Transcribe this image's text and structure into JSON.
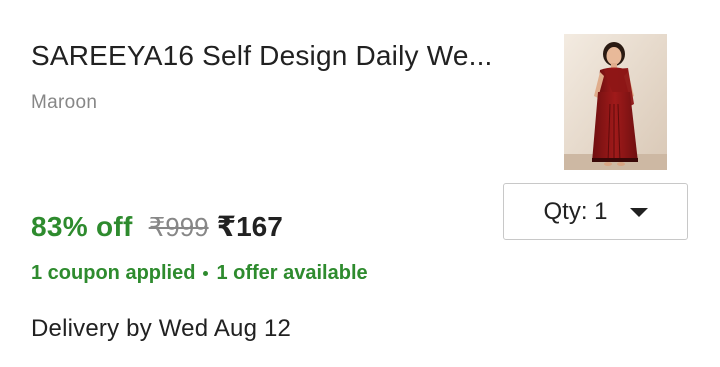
{
  "product": {
    "title": "SAREEYA16 Self Design Daily We...",
    "variant": "Maroon",
    "image_icon": "saree-product-image"
  },
  "pricing": {
    "discount": "83% off",
    "mrp": "₹999",
    "price": "₹167"
  },
  "offers": {
    "coupon": "1 coupon applied",
    "offer": "1 offer available"
  },
  "quantity": {
    "label": "Qty: 1"
  },
  "delivery": {
    "text": "Delivery by Wed Aug 12"
  },
  "colors": {
    "green": "#2e8b2e",
    "text": "#212121",
    "muted": "#878787",
    "saree": "#8b1414"
  }
}
